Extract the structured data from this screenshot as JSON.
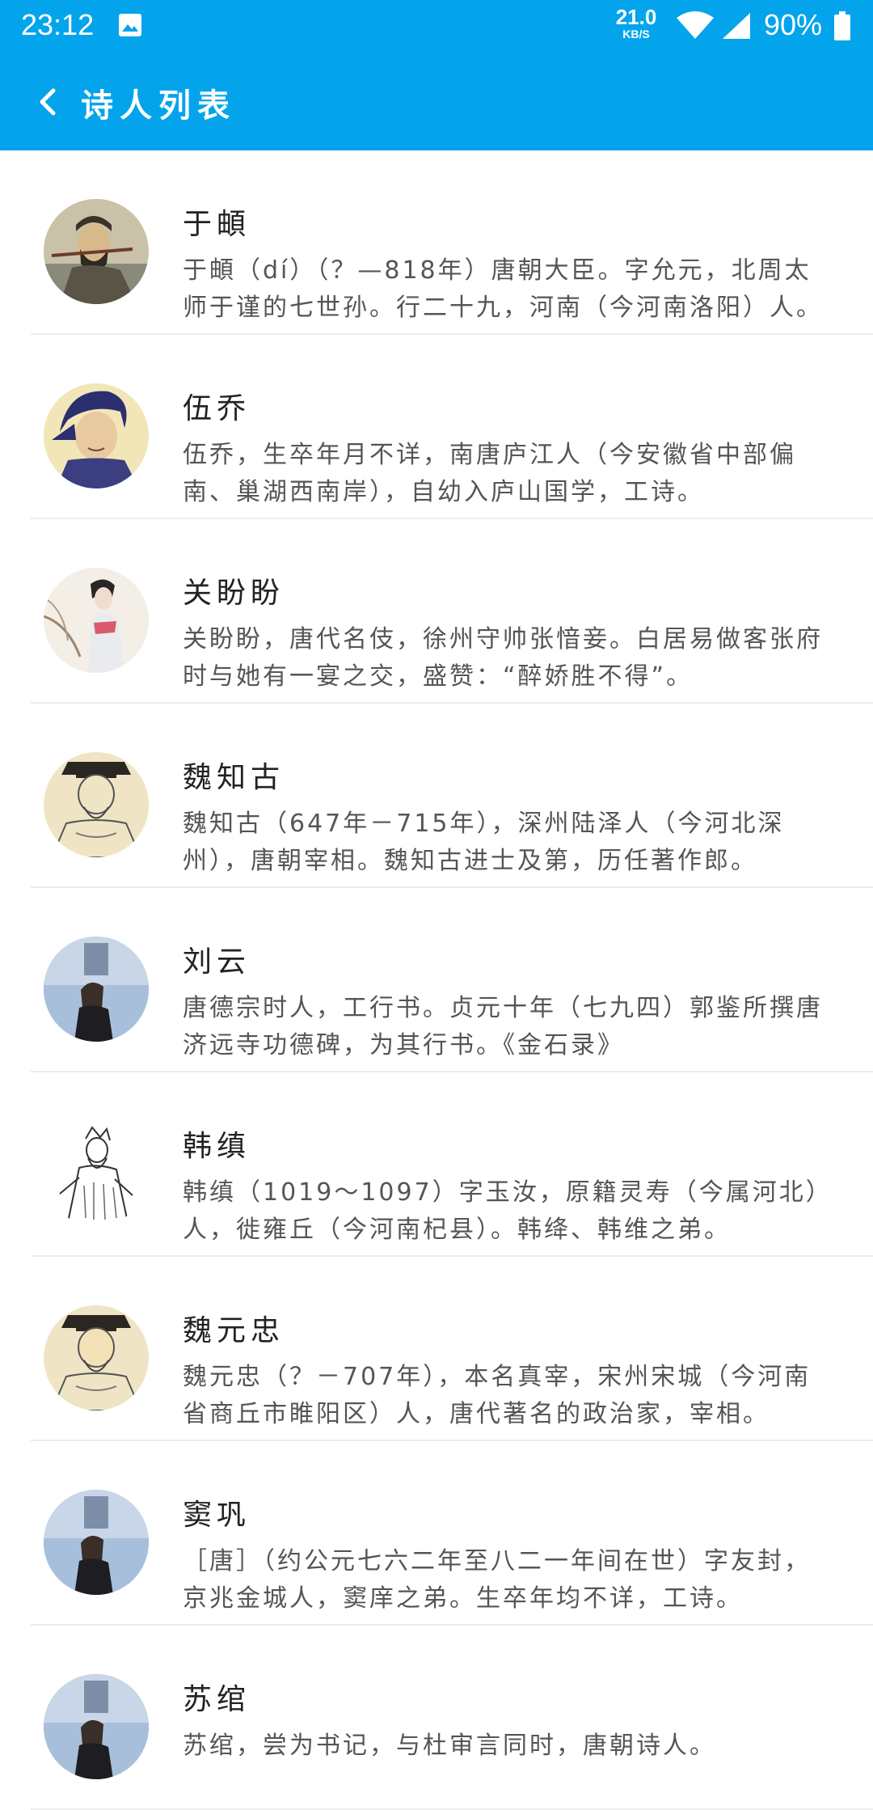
{
  "status_bar": {
    "time": "23:12",
    "net_speed_value": "21.0",
    "net_speed_unit": "KB/S",
    "battery": "90%",
    "icons": [
      "gallery-icon",
      "wifi-icon",
      "signal-icon",
      "battery-icon"
    ]
  },
  "app_bar": {
    "title": "诗人列表",
    "back_icon": "chevron-left-icon",
    "color": "#03a4ec"
  },
  "poets": [
    {
      "name": "于頔",
      "bio": "于頔（dí）（？—818年）唐朝大臣。字允元，北周太师于谨的七世孙。行二十九，河南（今河南洛阳）人。",
      "avatar": "portrait-scholar"
    },
    {
      "name": "伍乔",
      "bio": "伍乔，生卒年月不详，南唐庐江人（今安徽省中部偏南、巢湖西南岸），自幼入庐山国学，工诗。",
      "avatar": "portrait-official-blue"
    },
    {
      "name": "关盼盼",
      "bio": "关盼盼，唐代名伎，徐州守帅张愔妾。白居易做客张府时与她有一宴之交，盛赞：“醉娇胜不得”。",
      "avatar": "portrait-lady"
    },
    {
      "name": "魏知古",
      "bio": "魏知古（647年－715年），深州陆泽人（今河北深州），唐朝宰相。魏知古进士及第，历任著作郎。",
      "avatar": "portrait-official-hat"
    },
    {
      "name": "刘云",
      "bio": "唐德宗时人，工行书。贞元十年（七九四）郭鉴所撰唐济远寺功德碑，为其行书。《金石录》",
      "avatar": "photo-woman"
    },
    {
      "name": "韩缜",
      "bio": "韩缜（1019～1097）字玉汝，原籍灵寿（今属河北）人，徙雍丘（今河南杞县）。韩绛、韩维之弟。",
      "avatar": "sketch-scholar"
    },
    {
      "name": "魏元忠",
      "bio": "魏元忠（？－707年），本名真宰，宋州宋城（今河南省商丘市睢阳区）人，唐代著名的政治家，宰相。",
      "avatar": "portrait-official-hat"
    },
    {
      "name": "窦巩",
      "bio": "［唐］（约公元七六二年至八二一年间在世）字友封，京兆金城人，窦庠之弟。生卒年均不详，工诗。",
      "avatar": "photo-woman"
    },
    {
      "name": "苏绾",
      "bio": "苏绾，尝为书记，与杜审言同时，唐朝诗人。",
      "avatar": "photo-woman"
    }
  ]
}
